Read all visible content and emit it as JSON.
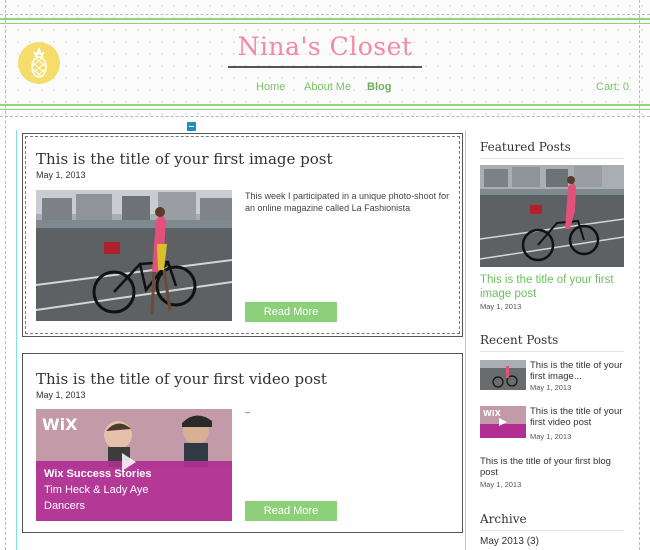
{
  "site": {
    "title": "Nina's Closet"
  },
  "nav": {
    "items": [
      "Home",
      "About Me",
      "Blog"
    ],
    "active": "Blog"
  },
  "cart": {
    "label": "Cart: 0"
  },
  "posts": [
    {
      "title": "This is the title of your first image post",
      "date": "May 1, 2013",
      "excerpt": "This week I participated in a unique photo-shoot for an online magazine called La Fashionista",
      "read_more": "Read More"
    },
    {
      "title": "This is the title of your first video post",
      "date": "May 1, 2013",
      "excerpt": "–",
      "read_more": "Read More",
      "video": {
        "brand": "WiX",
        "line1": "Wix Success Stories",
        "line2": "Tim Heck & Lady Aye",
        "line3": "Dancers"
      }
    }
  ],
  "sidebar": {
    "featured": {
      "heading": "Featured Posts",
      "title": "This is the title of your first image post",
      "date": "May 1, 2013"
    },
    "recent": {
      "heading": "Recent Posts",
      "items": [
        {
          "title": "This is the title of your first image...",
          "date": "May 1, 2013"
        },
        {
          "title": "This is the title of your first video post",
          "date": "May 1, 2013"
        },
        {
          "title": "This is the title of your first blog post",
          "date": "May 1, 2013"
        }
      ]
    },
    "archive": {
      "heading": "Archive",
      "items": [
        "May 2013 (3)"
      ]
    }
  },
  "colors": {
    "accent_green": "#8cd07a",
    "title_pink": "#f28aa0",
    "logo_yellow": "#f6dc6a"
  }
}
